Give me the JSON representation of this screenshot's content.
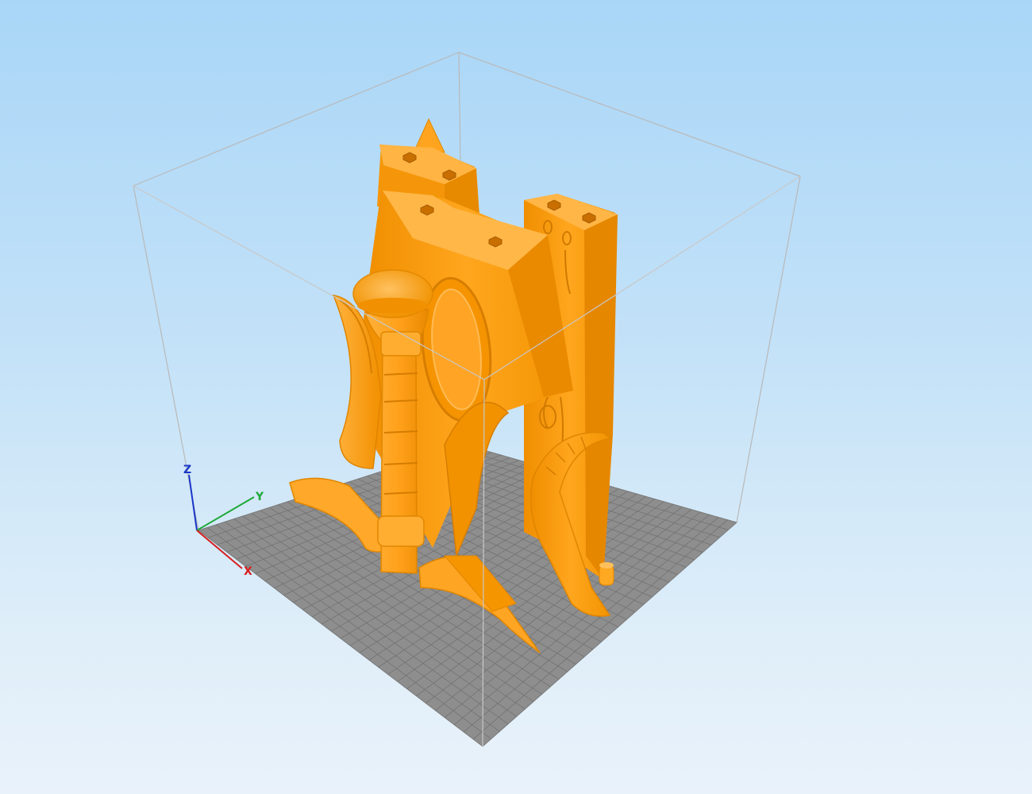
{
  "viewer": {
    "background_top": "#a9d6f7",
    "background_bottom": "#e9f2fa",
    "bed_color": "#8e8e8e",
    "bed_grid_color": "#6f6f6f",
    "model_color": "#ffa21a",
    "model_shade_color": "#e68a00",
    "model_highlight_color": "#ffbd52",
    "bounding_box_color": "#b8b8b8"
  },
  "axes": {
    "x": {
      "label": "X",
      "color": "#d81e1e"
    },
    "y": {
      "label": "Y",
      "color": "#1fa83a"
    },
    "z": {
      "label": "Z",
      "color": "#1a36c8"
    }
  }
}
